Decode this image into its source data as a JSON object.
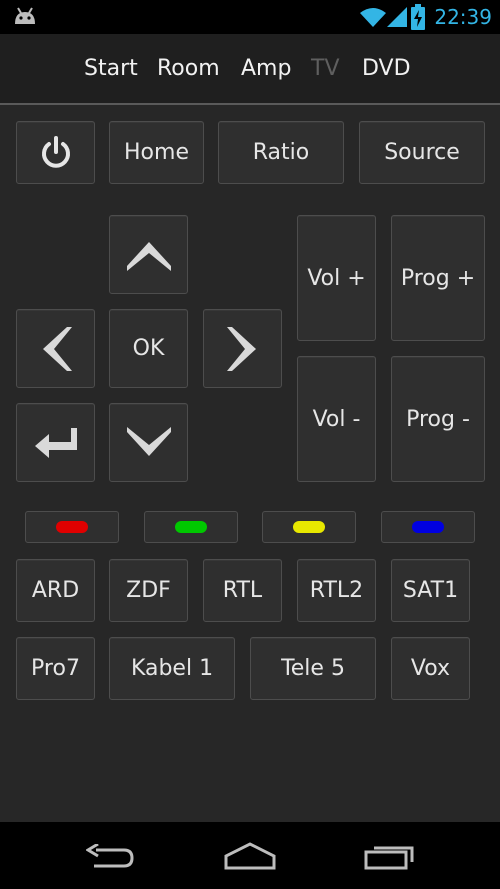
{
  "status_bar": {
    "time": "22:39",
    "android_icon": "android-icon",
    "wifi_icon": "wifi-icon",
    "signal_icon": "signal-icon",
    "battery_icon": "battery-charging-icon"
  },
  "top_nav": {
    "items": [
      {
        "label": "Start",
        "active": false
      },
      {
        "label": "Room",
        "active": false
      },
      {
        "label": "Amp",
        "active": false
      },
      {
        "label": "TV",
        "active": true
      },
      {
        "label": "DVD",
        "active": false
      }
    ]
  },
  "row1": {
    "power_icon": "power-icon",
    "home_label": "Home",
    "ratio_label": "Ratio",
    "source_label": "Source"
  },
  "dpad": {
    "up_icon": "chevron-up-icon",
    "left_icon": "chevron-left-icon",
    "ok_label": "OK",
    "right_icon": "chevron-right-icon",
    "back_icon": "return-icon",
    "down_icon": "chevron-down-icon"
  },
  "volume": {
    "vol_up_label": "Vol +",
    "vol_down_label": "Vol -",
    "prog_up_label": "Prog +",
    "prog_down_label": "Prog -"
  },
  "color_buttons": {
    "red": "#e00000",
    "green": "#00c800",
    "yellow": "#e8e800",
    "blue": "#0000e0"
  },
  "channels_row1": [
    "ARD",
    "ZDF",
    "RTL",
    "RTL2",
    "SAT1"
  ],
  "channels_row2": [
    "Pro7",
    "Kabel 1",
    "Tele 5",
    "Vox"
  ],
  "bottom_nav": {
    "back_icon": "back-icon",
    "home_icon": "home-icon",
    "recents_icon": "recents-icon"
  }
}
